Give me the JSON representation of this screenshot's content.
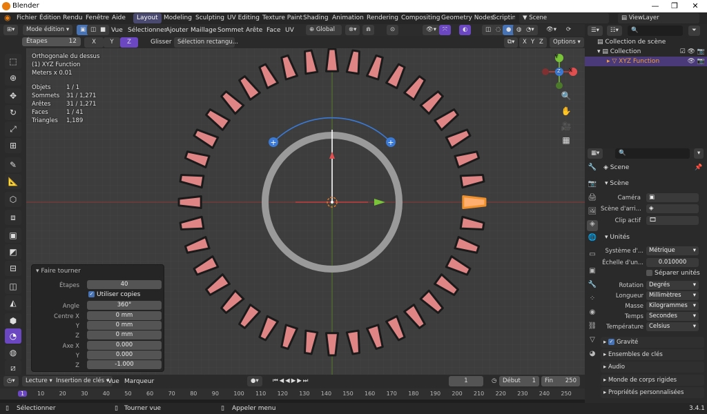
{
  "titlebar": {
    "app": "Blender",
    "min": "—",
    "max": "❐",
    "close": "✕"
  },
  "menu": {
    "items": [
      "Fichier",
      "Édition",
      "Rendu",
      "Fenêtre",
      "Aide"
    ],
    "workspaces": [
      "Layout",
      "Modeling",
      "Sculpting",
      "UV Editing",
      "Texture Paint",
      "Shading",
      "Animation",
      "Rendering",
      "Compositing",
      "Geometry Nodes",
      "Scripting"
    ],
    "active_workspace": "Layout",
    "scene": "Scene",
    "view_layer": "ViewLayer"
  },
  "viewport_header": {
    "mode": "Mode édition",
    "view": "Vue",
    "select": "Sélectionner",
    "add": "Ajouter",
    "mesh": "Maillage",
    "vertex": "Sommet",
    "edge": "Arête",
    "face": "Face",
    "uv": "UV",
    "orientation": "Global"
  },
  "tool_header": {
    "steps_label": "Étapes",
    "steps_value": "12",
    "x": "X",
    "y": "Y",
    "z": "Z",
    "drag_label": "Glisser :",
    "drag_value": "Sélection rectangu...",
    "options": "Options"
  },
  "overlay": {
    "view_name": "Orthogonale du dessus",
    "object_name": "(1) XYZ Function",
    "units": "Meters x 0.01",
    "stats": [
      {
        "label": "Objets",
        "value": "1 / 1"
      },
      {
        "label": "Sommets",
        "value": "31 / 1,271"
      },
      {
        "label": "Arêtes",
        "value": "31 / 1,271"
      },
      {
        "label": "Faces",
        "value": "1 / 41"
      },
      {
        "label": "Triangles",
        "value": "1,189"
      }
    ]
  },
  "gizmo": {
    "x": "X",
    "y": "Y",
    "z": "Z"
  },
  "redo_panel": {
    "title": "Faire tourner",
    "steps_label": "Étapes",
    "steps": "40",
    "use_copies": "Utiliser copies",
    "angle_label": "Angle",
    "angle": "360°",
    "center_x_label": "Centre X",
    "center_x": "0 mm",
    "y_label": "Y",
    "center_y": "0 mm",
    "z_label": "Z",
    "center_z": "0 mm",
    "axis_x_label": "Axe X",
    "axis_x": "0.000",
    "axis_y": "0.000",
    "axis_z": "-1.000"
  },
  "timeline": {
    "playback": "Lecture",
    "keying": "Insertion de clés",
    "view": "Vue",
    "marker": "Marqueur",
    "current_frame": "1",
    "start_label": "Début",
    "start": "1",
    "end_label": "Fin",
    "end": "250",
    "ticks": [
      "1",
      "10",
      "20",
      "30",
      "40",
      "50",
      "60",
      "70",
      "80",
      "90",
      "100",
      "110",
      "120",
      "130",
      "140",
      "150",
      "160",
      "170",
      "180",
      "190",
      "200",
      "210",
      "220",
      "230",
      "240",
      "250"
    ]
  },
  "statusbar": {
    "select": "Sélectionner",
    "rotate": "Tourner vue",
    "menu": "Appeler menu",
    "version": "3.4.1"
  },
  "outliner": {
    "scene_collection": "Collection de scène",
    "collection": "Collection",
    "object": "XYZ Function"
  },
  "properties": {
    "scene_title": "Scene",
    "section_scene": "Scène",
    "camera_label": "Caméra",
    "background_label": "Scène d'arri...",
    "clip_label": "Clip actif",
    "section_units": "Unités",
    "unit_system_label": "Système d'...",
    "unit_system": "Métrique",
    "unit_scale_label": "Échelle d'un...",
    "unit_scale": "0.010000",
    "separate_units": "Séparer unités",
    "rotation_label": "Rotation",
    "rotation": "Degrés",
    "length_label": "Longueur",
    "length": "Millimètres",
    "mass_label": "Masse",
    "mass": "Kilogrammes",
    "time_label": "Temps",
    "time": "Secondes",
    "temperature_label": "Température",
    "temperature": "Celsius",
    "gravity": "Gravité",
    "keying_sets": "Ensembles de clés",
    "audio": "Audio",
    "rigid_body": "Monde de corps rigides",
    "custom_props": "Propriétés personnalisées"
  },
  "colors": {
    "accent": "#4772b3",
    "purple": "#6b47c2",
    "tooth": "#e08585",
    "select": "#f0902a"
  }
}
